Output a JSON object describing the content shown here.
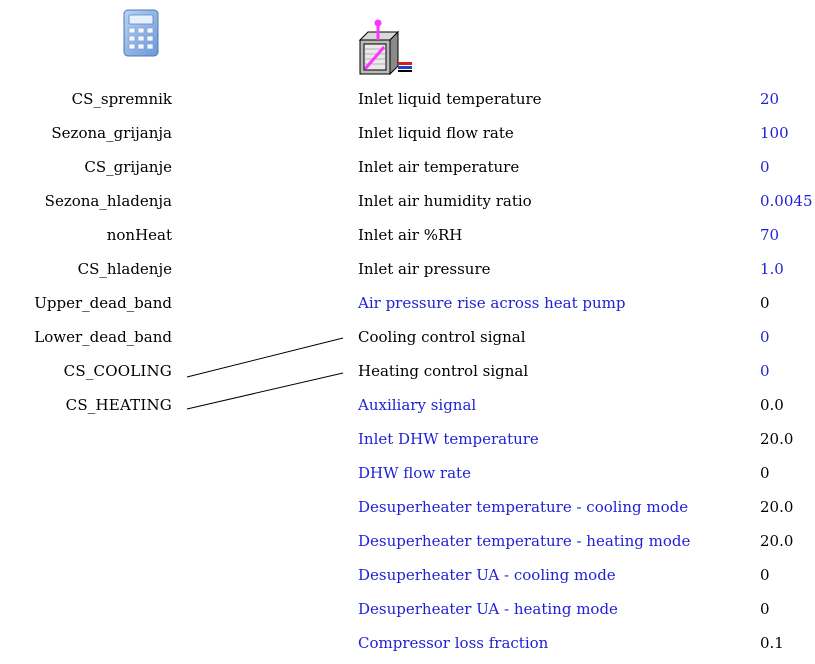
{
  "icons": {
    "left_component": "calculator-icon",
    "right_component": "heat-pump-icon"
  },
  "colors": {
    "linked_text": "#1f1fd6",
    "default_text": "#000000",
    "connection_line": "#000000"
  },
  "sources": [
    {
      "label": "CS_spremnik"
    },
    {
      "label": "Sezona_grijanja"
    },
    {
      "label": "CS_grijanje"
    },
    {
      "label": "Sezona_hladenja"
    },
    {
      "label": "nonHeat"
    },
    {
      "label": "CS_hladenje"
    },
    {
      "label": "Upper_dead_band"
    },
    {
      "label": "Lower_dead_band"
    },
    {
      "label": "CS_COOLING"
    },
    {
      "label": "CS_HEATING"
    }
  ],
  "parameters": [
    {
      "label": "Inlet liquid temperature",
      "value": "20",
      "label_color": "black",
      "value_color": "blue"
    },
    {
      "label": "Inlet liquid flow rate",
      "value": "100",
      "label_color": "black",
      "value_color": "blue"
    },
    {
      "label": "Inlet air temperature",
      "value": "0",
      "label_color": "black",
      "value_color": "blue"
    },
    {
      "label": "Inlet air humidity ratio",
      "value": "0.0045",
      "label_color": "black",
      "value_color": "blue"
    },
    {
      "label": "Inlet air %RH",
      "value": "70",
      "label_color": "black",
      "value_color": "blue"
    },
    {
      "label": "Inlet air pressure",
      "value": "1.0",
      "label_color": "black",
      "value_color": "blue"
    },
    {
      "label": "Air pressure rise across heat pump",
      "value": "0",
      "label_color": "blue",
      "value_color": "black"
    },
    {
      "label": "Cooling control signal",
      "value": "0",
      "label_color": "black",
      "value_color": "blue"
    },
    {
      "label": "Heating control signal",
      "value": "0",
      "label_color": "black",
      "value_color": "blue"
    },
    {
      "label": "Auxiliary signal",
      "value": "0.0",
      "label_color": "blue",
      "value_color": "black"
    },
    {
      "label": "Inlet DHW temperature",
      "value": "20.0",
      "label_color": "blue",
      "value_color": "black"
    },
    {
      "label": "DHW flow rate",
      "value": "0",
      "label_color": "blue",
      "value_color": "black"
    },
    {
      "label": "Desuperheater temperature - cooling mode",
      "value": "20.0",
      "label_color": "blue",
      "value_color": "black"
    },
    {
      "label": "Desuperheater temperature - heating mode",
      "value": "20.0",
      "label_color": "blue",
      "value_color": "black"
    },
    {
      "label": "Desuperheater UA - cooling mode",
      "value": "0",
      "label_color": "blue",
      "value_color": "black"
    },
    {
      "label": "Desuperheater UA - heating mode",
      "value": "0",
      "label_color": "blue",
      "value_color": "black"
    },
    {
      "label": "Compressor loss fraction",
      "value": "0.1",
      "label_color": "blue",
      "value_color": "black"
    }
  ],
  "connections": [
    {
      "from": "CS_COOLING",
      "to": "Cooling control signal"
    },
    {
      "from": "CS_HEATING",
      "to": "Heating control signal"
    }
  ]
}
